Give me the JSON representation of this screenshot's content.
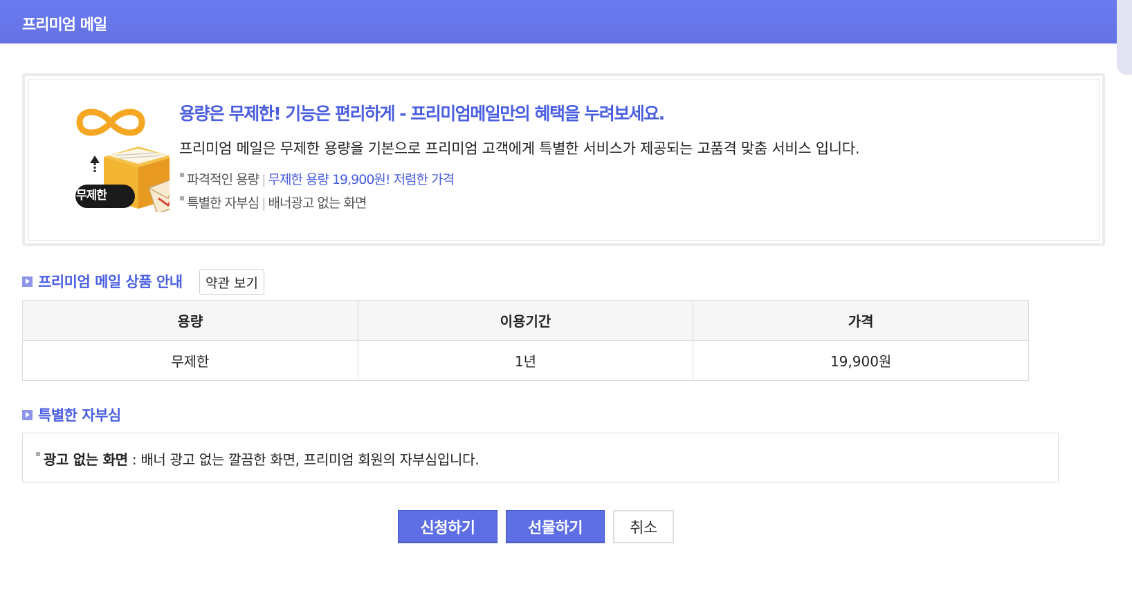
{
  "header": {
    "title": "프리미엄 메일"
  },
  "promo": {
    "icon_badge": "무제한",
    "headline": "용량은 무제한! 기능은 편리하게 - 프리미엄메일만의 혜택을 누려보세요.",
    "description": "프리미엄 메일은 무제한 용량을 기본으로 프리미엄 고객에게 특별한 서비스가 제공되는 고품격 맞춤 서비스 입니다.",
    "benefits": [
      {
        "label": "파격적인 용량",
        "detail": "무제한 용량 19,900원! 저렴한 가격"
      },
      {
        "label": "특별한 자부심",
        "detail": "배너광고 없는 화면"
      }
    ]
  },
  "product_section": {
    "title": "프리미엄 메일 상품 안내",
    "terms_button": "약관 보기",
    "table": {
      "headers": [
        "용량",
        "이용기간",
        "가격"
      ],
      "rows": [
        [
          "무제한",
          "1년",
          "19,900원"
        ]
      ]
    }
  },
  "pride_section": {
    "title": "특별한 자부심",
    "item_title": "광고 없는 화면",
    "item_text": " : 배너 광고 없는 깔끔한 화면, 프리미엄 회원의 자부심입니다."
  },
  "actions": {
    "apply": "신청하기",
    "gift": "선물하기",
    "cancel": "취소"
  },
  "colors": {
    "accent": "#4a5ee0",
    "header": "#6472e6",
    "button": "#5e6fe6"
  }
}
